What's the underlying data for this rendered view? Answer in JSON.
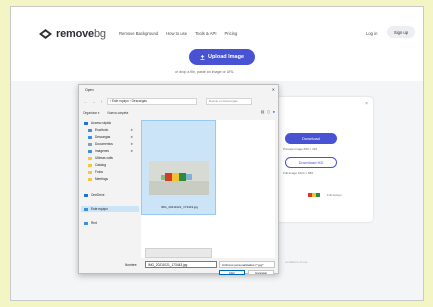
{
  "site": {
    "logo_text_bold": "remove",
    "logo_text_light": "bg",
    "nav": [
      "Remove Background",
      "How to use",
      "Tools & API",
      "Pricing"
    ],
    "login": "Log in",
    "signup": "Sign up",
    "upload_button": "Upload Image",
    "drop_hint": "or drop a file, paste an image or URL",
    "accent_color": "#4753d3"
  },
  "result_card": {
    "close": "×",
    "download": "Download",
    "download_note": "Preview Image 500 × 333",
    "download_hd": "Download HD",
    "download_hd_note": "Full Image 1024 × 683",
    "thumb_label": "Full design",
    "bottom_link": "conditions of use"
  },
  "dialog": {
    "title": "Open",
    "close": "✕",
    "nav_back": "←",
    "nav_forward": "→",
    "nav_up": "↑",
    "address": "› Este equipo › Descargas",
    "search_placeholder": "Buscar en Descargas",
    "toolbar": [
      "Organizar ▾",
      "Nueva carpeta"
    ],
    "sidebar": [
      {
        "label": "Acceso rápido",
        "icon": "star-icon",
        "color": "#1e6fd9",
        "pinned": false,
        "selected": false
      },
      {
        "label": "Escritorio",
        "icon": "desktop-icon",
        "color": "#3b8ede",
        "pinned": true,
        "selected": false
      },
      {
        "label": "Descargas",
        "icon": "download-icon",
        "color": "#3b8ede",
        "pinned": true,
        "selected": false
      },
      {
        "label": "Documentos",
        "icon": "document-icon",
        "color": "#8a9bb0",
        "pinned": true,
        "selected": false
      },
      {
        "label": "Imágenes",
        "icon": "picture-icon",
        "color": "#3b8ede",
        "pinned": true,
        "selected": false
      },
      {
        "label": "Ultimas calls",
        "icon": "folder-icon",
        "color": "#f5c542",
        "pinned": false,
        "selected": false
      },
      {
        "label": "Catalog",
        "icon": "folder-icon",
        "color": "#f5c542",
        "pinned": false,
        "selected": false
      },
      {
        "label": "Fotos",
        "icon": "folder-icon",
        "color": "#f5c542",
        "pinned": false,
        "selected": false
      },
      {
        "label": "Meetings",
        "icon": "folder-icon",
        "color": "#f5c542",
        "pinned": false,
        "selected": false
      },
      {
        "label": "OneDrive",
        "icon": "cloud-icon",
        "color": "#1e6fd9",
        "pinned": false,
        "selected": false
      },
      {
        "label": "Este equipo",
        "icon": "computer-icon",
        "color": "#3b8ede",
        "pinned": false,
        "selected": true
      },
      {
        "label": "Red",
        "icon": "network-icon",
        "color": "#3b8ede",
        "pinned": false,
        "selected": false
      }
    ],
    "file_name": "IMG_20211021_173443.jpg",
    "filename_label": "Nombre:",
    "filename_value": "IMG_20211021_173443.jpg",
    "filetype": "Archivos personalizados (*.jpg*",
    "open": "Abrir",
    "cancel": "Cancelar"
  }
}
